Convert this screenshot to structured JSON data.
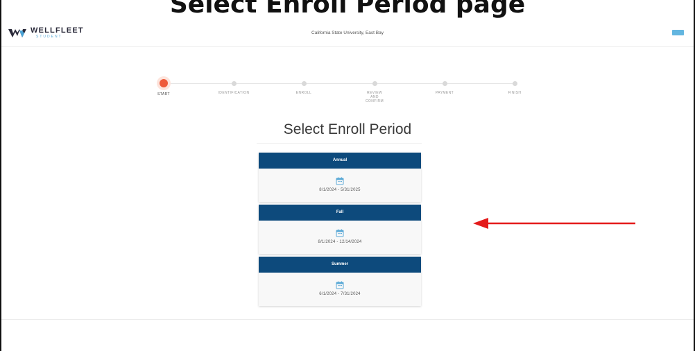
{
  "caption": {
    "text": "Select Enroll Period page"
  },
  "header": {
    "logo_text": "WELLFLEET",
    "logo_sub": "STUDENT",
    "school": "California State University, East Bay"
  },
  "steps": [
    {
      "label": "START",
      "active": true
    },
    {
      "label": "IDENTIFICATION",
      "active": false
    },
    {
      "label": "ENROLL",
      "active": false
    },
    {
      "label": "REVIEW AND CONFIRM",
      "active": false
    },
    {
      "label": "PAYMENT",
      "active": false
    },
    {
      "label": "FINISH",
      "active": false
    }
  ],
  "main": {
    "title": "Select Enroll Period",
    "periods": [
      {
        "name": "Annual",
        "dates": "8/1/2024 - 5/31/2025"
      },
      {
        "name": "Fall",
        "dates": "8/1/2024 - 12/14/2024"
      },
      {
        "name": "Summer",
        "dates": "6/1/2024 - 7/31/2024"
      }
    ]
  },
  "colors": {
    "header_bar": "#0d4a7c",
    "active_step": "#ee5a3a",
    "calendar_icon": "#5aa9d6",
    "annotation_arrow": "#e41b1b",
    "menu_button": "#63b6e0"
  },
  "icons": {
    "logo": "wellfleet-logo-icon",
    "menu": "menu-icon",
    "calendar": "calendar-icon",
    "annotation": "arrow-left-icon"
  }
}
